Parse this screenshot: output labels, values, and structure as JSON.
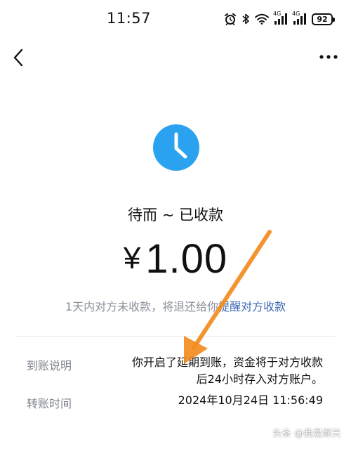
{
  "status_bar": {
    "time": "11:57",
    "network_1": "4G",
    "network_2": "4G",
    "battery": "92",
    "icons": [
      "alarm-icon",
      "bluetooth-icon",
      "wifi-icon",
      "signal-icon",
      "signal-icon",
      "battery-icon"
    ]
  },
  "nav": {
    "back_icon": "chevron-left-icon",
    "more_icon": "more-dots-icon"
  },
  "transfer": {
    "status_icon": "clock-icon",
    "status_title": "待而 ~ 已收款",
    "currency": "¥",
    "amount": "1.00",
    "notice": "1天内对方未收款，将退还给你",
    "remind_link": "提醒对方收款"
  },
  "details": {
    "arrival_label": "到账说明",
    "arrival_value_line1": "你开启了延期到账，资金将于对方收款",
    "arrival_value_line2": "后24小时存入对方账户。",
    "time_label": "转账时间",
    "time_value": "2024年10月24日 11:56:49"
  },
  "watermark": "头条 @我是邱天",
  "colors": {
    "accent_blue": "#2aa2ef",
    "link_blue": "#3d69b4",
    "muted_text": "#8a8f99",
    "annotation_arrow": "#f28c1e"
  }
}
